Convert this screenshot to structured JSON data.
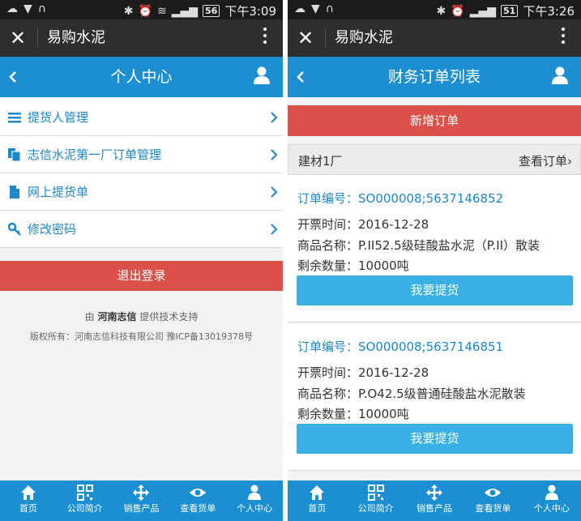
{
  "left": {
    "status": {
      "battery": "56",
      "time": "下午3:09"
    },
    "app_title": "易购水泥",
    "header_title": "个人中心",
    "menu": [
      {
        "label": "提货人管理",
        "icon": "list-icon"
      },
      {
        "label": "志信水泥第一厂订单管理",
        "icon": "documents-icon"
      },
      {
        "label": "网上提货单",
        "icon": "file-icon"
      },
      {
        "label": "修改密码",
        "icon": "key-icon"
      }
    ],
    "logout_label": "退出登录",
    "support": {
      "prefix": "由",
      "company": "河南志信",
      "suffix": "提供技术支持"
    },
    "copyright": "版权所有：河南志信科技有限公司 豫ICP备13019378号"
  },
  "right": {
    "status": {
      "battery": "51",
      "time": "下午3:26"
    },
    "app_title": "易购水泥",
    "header_title": "财务订单列表",
    "add_order_label": "新增订单",
    "factory": {
      "name": "建材1厂",
      "view_label": "查看订单"
    },
    "orders": [
      {
        "order_no": "订单编号：SO000008;5637146852",
        "invoice_time": "开票时间：2016-12-28",
        "product": "商品名称：P.II52.5级硅酸盐水泥（P.II）散装",
        "remaining": "剩余数量：10000吨",
        "pickup_label": "我要提货"
      },
      {
        "order_no": "订单编号：SO000008;5637146851",
        "invoice_time": "开票时间：2016-12-28",
        "product": "商品名称：P.O42.5级普通硅酸盐水泥散装",
        "remaining": "剩余数量：10000吨",
        "pickup_label": "我要提货"
      }
    ]
  },
  "tabs": [
    {
      "label": "首页",
      "icon": "home-icon"
    },
    {
      "label": "公司简介",
      "icon": "qr-code-icon"
    },
    {
      "label": "销售产品",
      "icon": "move-arrows-icon"
    },
    {
      "label": "查看货单",
      "icon": "eye-icon"
    },
    {
      "label": "个人中心",
      "icon": "user-icon"
    }
  ],
  "colors": {
    "primary_blue": "#1c8fd2",
    "red": "#db5149",
    "button_blue": "#38b0e6",
    "dark_bar": "#2c2e30",
    "link_blue": "#1d87c9"
  }
}
